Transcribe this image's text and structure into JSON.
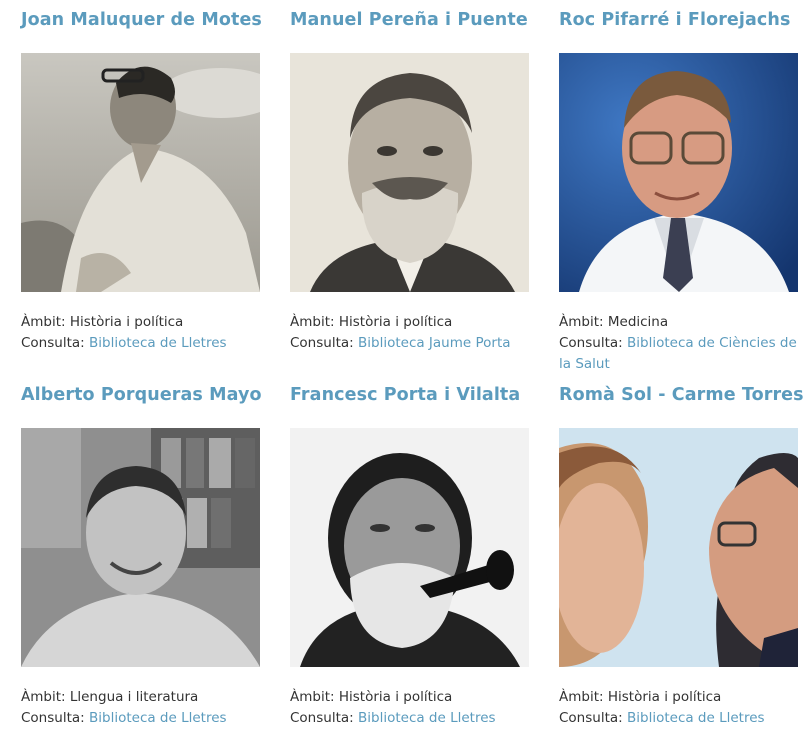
{
  "people": [
    {
      "name": "Joan Maluquer de Motes",
      "ambit_label": "Àmbit:",
      "ambit": "Història i política",
      "consulta_label": "Consulta:",
      "consulta": "Biblioteca de Lletres",
      "photo": "person-photo"
    },
    {
      "name": "Manuel Pereña i Puente",
      "ambit_label": "Àmbit:",
      "ambit": "Història i política",
      "consulta_label": "Consulta:",
      "consulta": "Biblioteca Jaume Porta",
      "photo": "person-photo"
    },
    {
      "name": "Roc Pifarré i Florejachs",
      "ambit_label": "Àmbit:",
      "ambit": "Medicina",
      "consulta_label": "Consulta:",
      "consulta": "Biblioteca de Ciències de la Salut",
      "photo": "person-photo"
    },
    {
      "name": "Alberto Porqueras Mayo",
      "ambit_label": "Àmbit:",
      "ambit": "Llengua i literatura",
      "consulta_label": "Consulta:",
      "consulta": "Biblioteca de Lletres",
      "photo": "person-photo"
    },
    {
      "name": "Francesc Porta i Vilalta",
      "ambit_label": "Àmbit:",
      "ambit": "Història i política",
      "consulta_label": "Consulta:",
      "consulta": "Biblioteca de Lletres",
      "photo": "person-photo"
    },
    {
      "name": "Romà Sol - Carme Torres",
      "ambit_label": "Àmbit:",
      "ambit": "Història i política",
      "consulta_label": "Consulta:",
      "consulta": "Biblioteca de Lletres",
      "photo": "person-photo"
    }
  ],
  "colors": {
    "link": "#5b9bbd",
    "text": "#333333"
  }
}
